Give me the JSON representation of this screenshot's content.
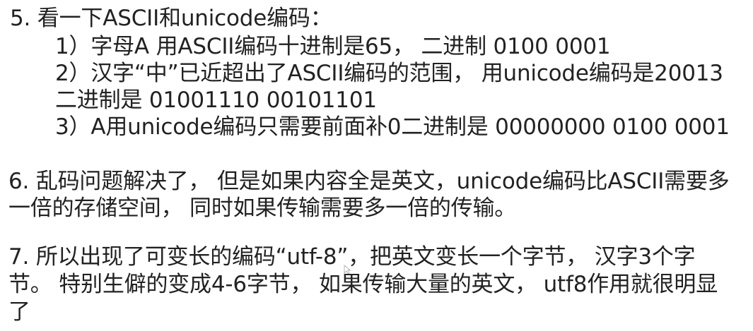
{
  "sections": [
    {
      "heading": "5. 看一下ASCII和unicode编码：",
      "items": [
        "1）字母A 用ASCII编码十进制是65， 二进制 0100 0001",
        "2）汉字“中”已近超出了ASCII编码的范围， 用unicode编码是20013",
        "二进制是 01001110 00101101",
        "3）A用unicode编码只需要前面补0二进制是 00000000 0100 0001"
      ]
    },
    {
      "lines": [
        "6. 乱码问题解决了， 但是如果内容全是英文，unicode编码比ASCII需要多",
        "一倍的存储空间， 同时如果传输需要多一倍的传输。"
      ]
    },
    {
      "lines": [
        "7. 所以出现了可变长的编码“utf-8”，把英文变长一个字节， 汉字3个字",
        "节。 特别生僻的变成4-6字节， 如果传输大量的英文， utf8作用就很明显",
        "了"
      ]
    }
  ],
  "cursor_icon": "mouse-pointer-icon"
}
